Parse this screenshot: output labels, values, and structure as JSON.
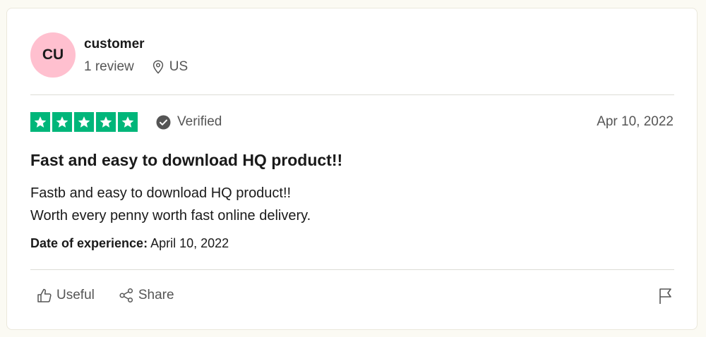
{
  "reviewer": {
    "initials": "CU",
    "avatar_color": "#ffc0cf",
    "name": "customer",
    "review_count": "1 review",
    "location": "US"
  },
  "rating": {
    "stars": 5,
    "max": 5,
    "star_color": "#00b67a",
    "verified_label": "Verified",
    "date": "Apr 10, 2022"
  },
  "review": {
    "title": "Fast and easy to download HQ product!!",
    "lines": [
      "Fastb and easy to download HQ product!!",
      "Worth every penny worth fast online delivery."
    ],
    "experience_label": "Date of experience:",
    "experience_date": "April 10, 2022"
  },
  "actions": {
    "useful_label": "Useful",
    "share_label": "Share",
    "report_icon": "flag-icon"
  }
}
